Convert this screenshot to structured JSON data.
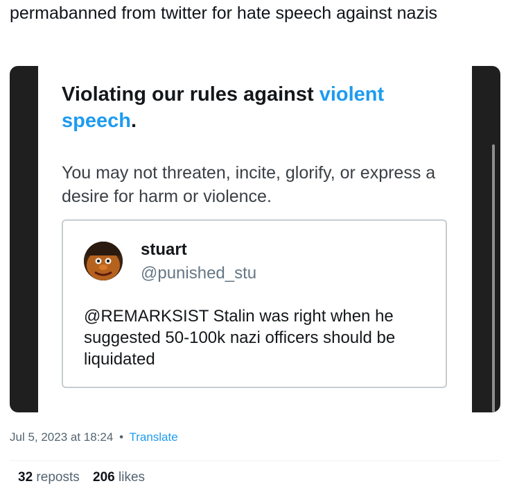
{
  "post": {
    "text": "permabanned from twitter for hate speech against nazis"
  },
  "notice": {
    "heading_prefix": "Violating our rules against ",
    "heading_link": "violent speech",
    "heading_suffix": ".",
    "description": "You may not threaten, incite, glorify, or express a desire for harm or violence."
  },
  "quoted_tweet": {
    "author_name": "stuart",
    "author_handle": "@punished_stu",
    "text": "@REMARKSIST Stalin was right when he suggested 50-100k nazi officers should be liquidated"
  },
  "meta": {
    "timestamp": "Jul 5, 2023 at 18:24",
    "separator": "•",
    "translate_label": "Translate"
  },
  "stats": {
    "reposts_count": "32",
    "reposts_label": "reposts",
    "likes_count": "206",
    "likes_label": "likes"
  },
  "colors": {
    "link_blue": "#1d9bf0",
    "media_background": "#1f1f1f"
  }
}
